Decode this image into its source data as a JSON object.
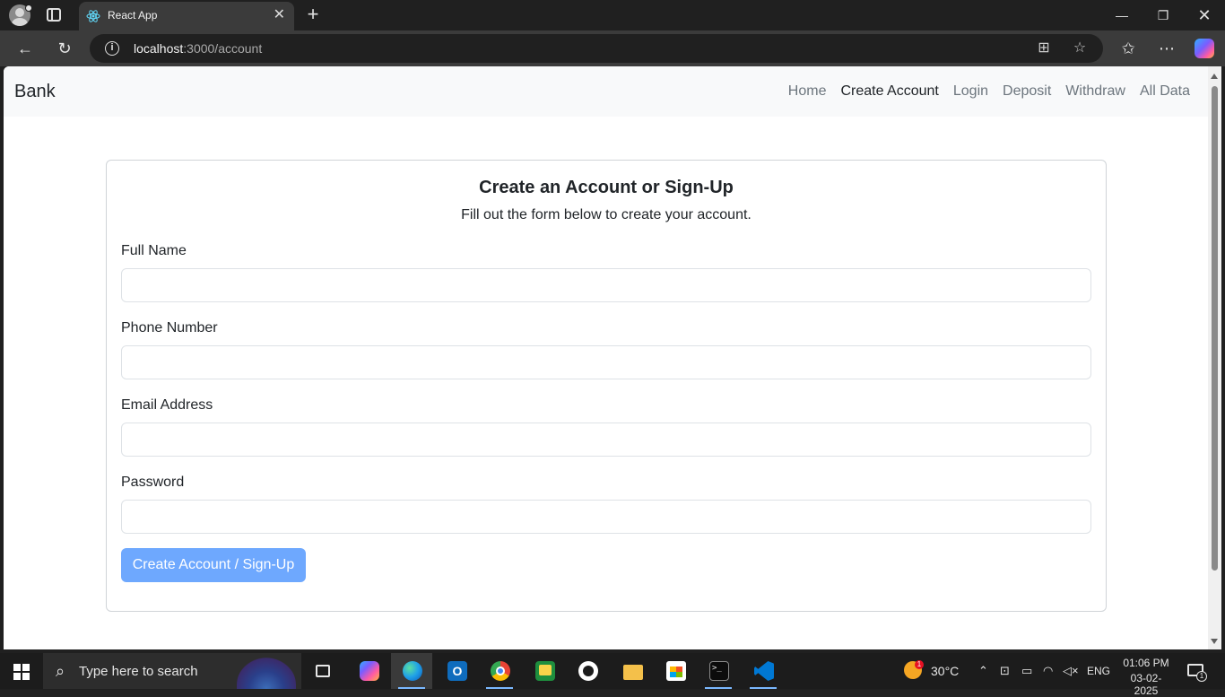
{
  "browser": {
    "tab_title": "React App",
    "new_tab_label": "+",
    "url_host": "localhost",
    "url_path": ":3000/account"
  },
  "navbar": {
    "brand": "Bank",
    "links": [
      "Home",
      "Create Account",
      "Login",
      "Deposit",
      "Withdraw",
      "All Data"
    ],
    "active_link": "Create Account"
  },
  "form": {
    "title": "Create an Account or Sign-Up",
    "subtitle": "Fill out the form below to create your account.",
    "fields": [
      {
        "label": "Full Name",
        "value": ""
      },
      {
        "label": "Phone Number",
        "value": ""
      },
      {
        "label": "Email Address",
        "value": ""
      },
      {
        "label": "Password",
        "value": ""
      }
    ],
    "submit_label": "Create Account / Sign-Up",
    "submit_color": "#6ea8fe"
  },
  "taskbar": {
    "search_placeholder": "Type here to search",
    "weather_temp": "30°C",
    "weather_badge": "1",
    "language": "ENG",
    "time": "01:06 PM",
    "date": "03-02-2025",
    "notification_count": "1"
  },
  "colors": {
    "navbar_bg": "#f8f9fa",
    "link_muted": "#6c757d",
    "text": "#212529"
  }
}
